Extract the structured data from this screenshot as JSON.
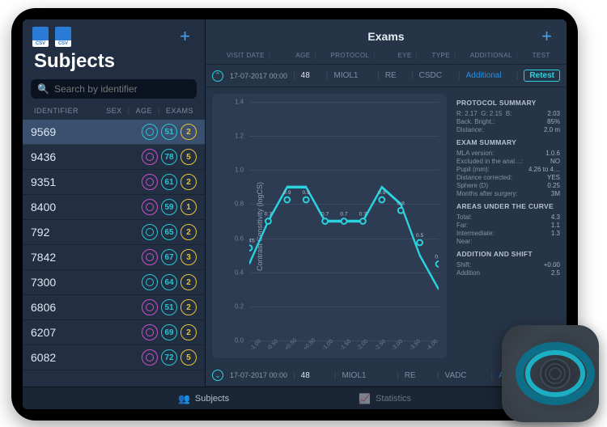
{
  "sidebar": {
    "title": "Subjects",
    "search_placeholder": "Search by identifier",
    "headers": {
      "left": "IDENTIFIER",
      "sex": "SEX",
      "age": "AGE",
      "exams": "EXAMS"
    },
    "subjects": [
      {
        "id": "9569",
        "sex_color": "#2bc3d4",
        "age": 51,
        "age_color": "#2bc3d4",
        "exams": 2,
        "exams_color": "#e8c33a",
        "selected": true
      },
      {
        "id": "9436",
        "sex_color": "#c94fcc",
        "age": 78,
        "age_color": "#2bc3d4",
        "exams": 5,
        "exams_color": "#e8c33a"
      },
      {
        "id": "9351",
        "sex_color": "#c94fcc",
        "age": 61,
        "age_color": "#2bc3d4",
        "exams": 2,
        "exams_color": "#e8c33a"
      },
      {
        "id": "8400",
        "sex_color": "#c94fcc",
        "age": 59,
        "age_color": "#2bc3d4",
        "exams": 1,
        "exams_color": "#e8c33a"
      },
      {
        "id": "792",
        "sex_color": "#2bc3d4",
        "age": 65,
        "age_color": "#2bc3d4",
        "exams": 2,
        "exams_color": "#e8c33a"
      },
      {
        "id": "7842",
        "sex_color": "#c94fcc",
        "age": 67,
        "age_color": "#2bc3d4",
        "exams": 3,
        "exams_color": "#e8c33a"
      },
      {
        "id": "7300",
        "sex_color": "#2bc3d4",
        "age": 64,
        "age_color": "#2bc3d4",
        "exams": 2,
        "exams_color": "#e8c33a"
      },
      {
        "id": "6806",
        "sex_color": "#c94fcc",
        "age": 51,
        "age_color": "#2bc3d4",
        "exams": 2,
        "exams_color": "#e8c33a"
      },
      {
        "id": "6207",
        "sex_color": "#c94fcc",
        "age": 69,
        "age_color": "#2bc3d4",
        "exams": 2,
        "exams_color": "#e8c33a"
      },
      {
        "id": "6082",
        "sex_color": "#c94fcc",
        "age": 72,
        "age_color": "#2bc3d4",
        "exams": 5,
        "exams_color": "#e8c33a"
      }
    ]
  },
  "content": {
    "title": "Exams",
    "headers": [
      "VISIT DATE",
      "AGE",
      "PROTOCOL",
      "EYE",
      "TYPE",
      "ADDITIONAL",
      "TEST"
    ],
    "exams": [
      {
        "expanded": true,
        "date": "17-07-2017 00:00",
        "age": "48",
        "protocol": "MIOL1",
        "eye": "RE",
        "type": "CSDC",
        "additional": "Additional",
        "test": "Retest"
      },
      {
        "expanded": false,
        "date": "17-07-2017 00:00",
        "age": "48",
        "protocol": "MIOL1",
        "eye": "RE",
        "type": "VADC",
        "additional": "Additional",
        "test": ""
      }
    ]
  },
  "chart_data": {
    "type": "line",
    "title": "",
    "xlabel": "",
    "ylabel": "Contrast Sensitivity (logCS)",
    "ylim": [
      0.0,
      1.4
    ],
    "yticks": [
      0.0,
      0.2,
      0.4,
      0.6,
      0.8,
      1.0,
      1.2,
      1.4
    ],
    "x": [
      "-1.00",
      "-0.50",
      "+0.50",
      "+0.50",
      "-1.00",
      "-1.50",
      "-2.00",
      "-2.50",
      "-3.00",
      "-3.50",
      "-4.00"
    ],
    "values": [
      0.45,
      0.7,
      0.9,
      0.9,
      0.7,
      0.7,
      0.7,
      0.9,
      0.8,
      0.5,
      0.3
    ],
    "point_labels": [
      "0.45",
      "0.7",
      "0.9",
      "0.9",
      "0.7",
      "0.7",
      "0.7",
      "0.9",
      "0.8",
      "0.5",
      "0.3"
    ],
    "color": "#29d3e0"
  },
  "summary": {
    "protocol_title": "PROTOCOL SUMMARY",
    "protocol": {
      "rgb_label_r": "R:",
      "r": "2.17",
      "rgb_label_g": "G:",
      "g": "2.15",
      "rgb_label_b": "B:",
      "b": "2.03",
      "back_bright_label": "Back. Bright.:",
      "back_bright": "85%",
      "distance_label": "Distance:",
      "distance": "2.0 m"
    },
    "exam_title": "EXAM SUMMARY",
    "exam": {
      "mla_label": "MLA version:",
      "mla": "1.0.6",
      "excl_label": "Excluded in the anal…:",
      "excl": "NO",
      "pupil_label": "Pupil (mm):",
      "pupil": "4.26 to 4…",
      "distc_label": "Distance corrected:",
      "distc": "YES",
      "sphere_label": "Sphere (D)",
      "sphere": "0.25",
      "months_label": "Months after surgery:",
      "months": "3M"
    },
    "areas_title": "AREAS UNDER THE CURVE",
    "areas": {
      "total_label": "Total:",
      "total": "4.3",
      "far_label": "Far:",
      "far": "1.1",
      "int_label": "Intermediate:",
      "int": "1.3",
      "near_label": "Near:",
      "near": ""
    },
    "addshift_title": "ADDITION AND SHIFT",
    "addshift": {
      "shift_label": "Shift:",
      "shift": "+0.00",
      "add_label": "Addition",
      "add": "2.5"
    }
  },
  "bottom": {
    "subjects": "Subjects",
    "statistics": "Statistics"
  }
}
